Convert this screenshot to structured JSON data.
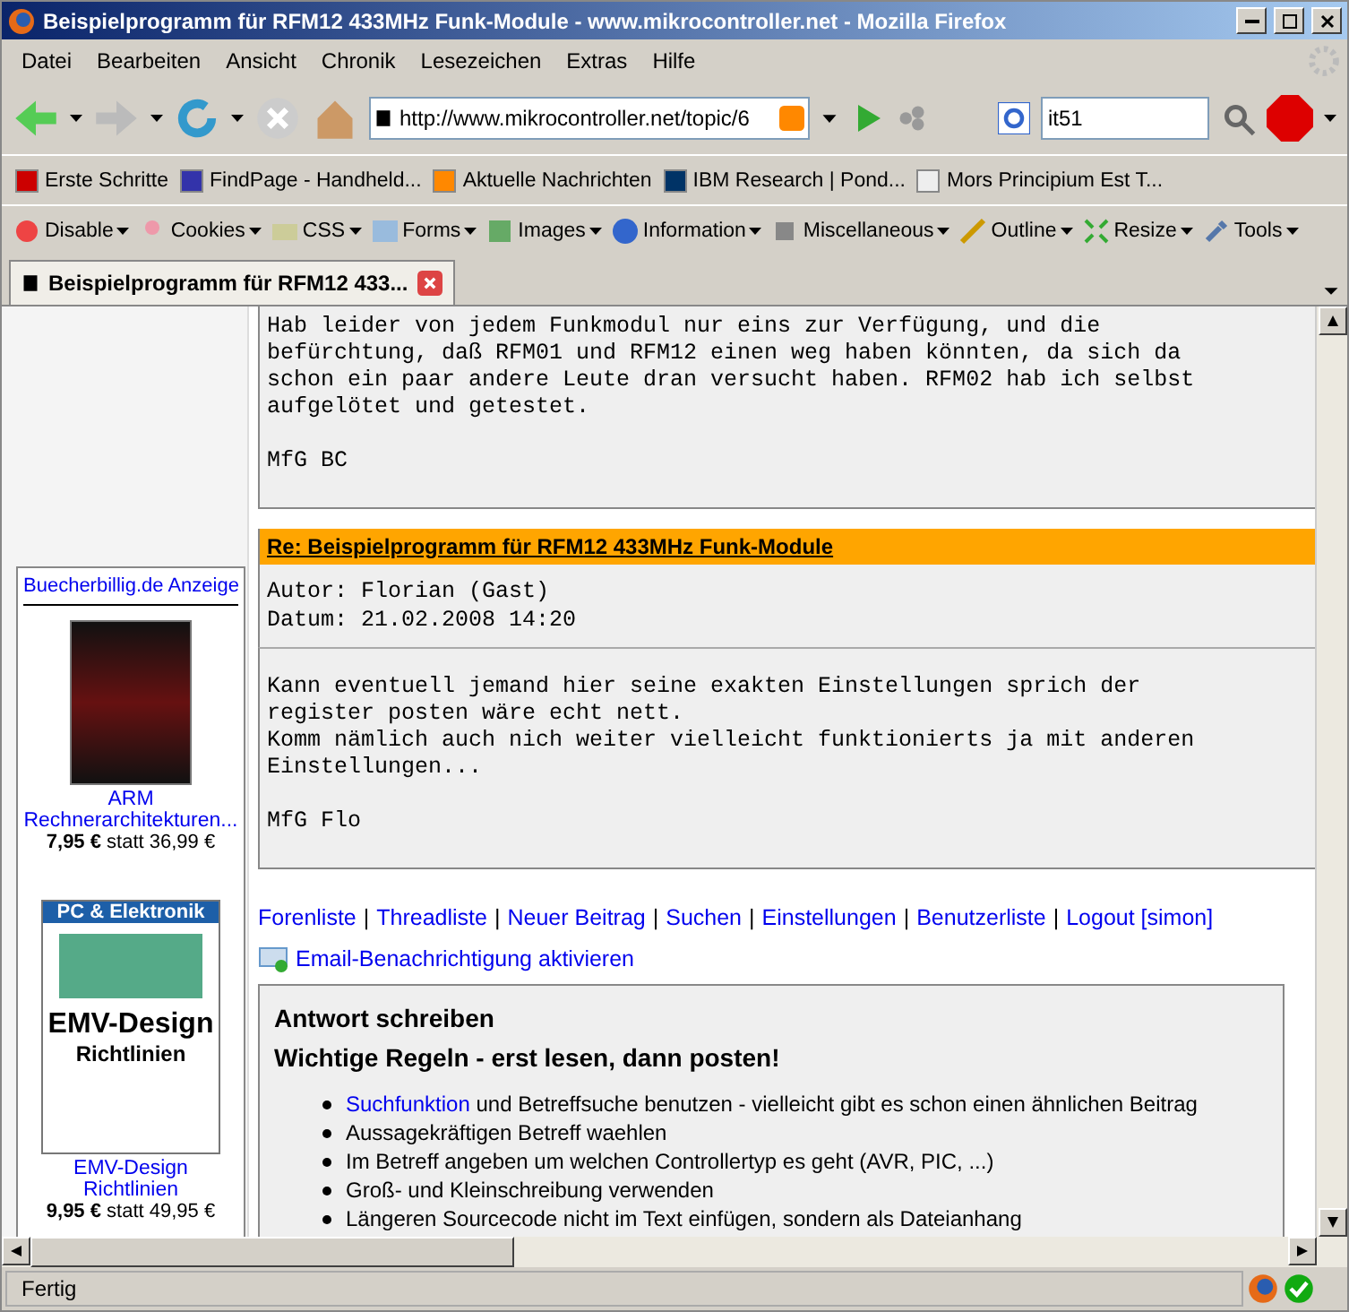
{
  "window": {
    "title": "Beispielprogramm für RFM12 433MHz Funk-Module - www.mikrocontroller.net - Mozilla Firefox"
  },
  "menu": [
    "Datei",
    "Bearbeiten",
    "Ansicht",
    "Chronik",
    "Lesezeichen",
    "Extras",
    "Hilfe"
  ],
  "navigation": {
    "url": "http://www.mikrocontroller.net/topic/6",
    "search_value": "it51"
  },
  "bookmarks": [
    "Erste Schritte",
    "FindPage - Handheld...",
    "Aktuelle Nachrichten",
    "IBM Research | Pond...",
    "Mors Principium Est T..."
  ],
  "webdev_toolbar": [
    "Disable",
    "Cookies",
    "CSS",
    "Forms",
    "Images",
    "Information",
    "Miscellaneous",
    "Outline",
    "Resize",
    "Tools"
  ],
  "tabs": [
    {
      "label": "Beispielprogramm für RFM12 433...",
      "selected": true
    }
  ],
  "sidebar_ad": {
    "title": "Buecherbillig.de Anzeige",
    "books": [
      {
        "kind": "dark",
        "title": "ARM Rechnerarchitekturen...",
        "price": "**7,95 €** statt 36,99 €"
      },
      {
        "kind": "light",
        "cover_title": "PC & Elektronik",
        "cover_main": "EMV-Design",
        "cover_sub": "Richtlinien",
        "title": "EMV-Design Richtlinien",
        "price": "**9,95 €** statt 49,95 €"
      }
    ]
  },
  "posts": [
    {
      "body": "Hab leider von jedem Funkmodul nur eins zur Verfügung, und die\nbefürchtung, daß RFM01 und RFM12 einen weg haben könnten, da sich da\nschon ein paar andere Leute dran versucht haben. RFM02 hab ich selbst\naufgelötet und getestet.\n\nMfG BC"
    },
    {
      "subject": "Re: Beispielprogramm für RFM12 433MHz Funk-Module",
      "author": "Autor: Florian (Gast)",
      "date": "Datum: 21.02.2008 14:20",
      "body": "Kann eventuell jemand hier seine exakten Einstellungen sprich der\nregister posten wäre echt nett.\nKomm nämlich auch nich weiter vielleicht funktionierts ja mit anderen\nEinstellungen...\n\nMfG Flo"
    }
  ],
  "link_separator": "|",
  "forum_links": [
    "Forenliste",
    "Threadliste",
    "Neuer Beitrag",
    "Suchen",
    "Einstellungen",
    "Benutzerliste",
    "Logout [simon]"
  ],
  "email_link": "Email-Benachrichtigung aktivieren",
  "reply": {
    "heading": "Antwort schreiben",
    "rules_heading": "Wichtige Regeln - erst lesen, dann posten!",
    "rules": [
      {
        "link": "Suchfunktion",
        "text": "und Betreffsuche benutzen - vielleicht gibt es schon einen ähnlichen Beitrag"
      },
      {
        "text": "Aussagekräftigen Betreff waehlen"
      },
      {
        "text": "Im Betreff angeben um welchen Controllertyp es geht (AVR, PIC, ...)"
      },
      {
        "text": "Groß- und Kleinschreibung verwenden"
      },
      {
        "text": "Längeren Sourcecode nicht im Text einfügen, sondern als Dateianhang"
      }
    ]
  },
  "status_bar": {
    "text": "Fertig"
  }
}
